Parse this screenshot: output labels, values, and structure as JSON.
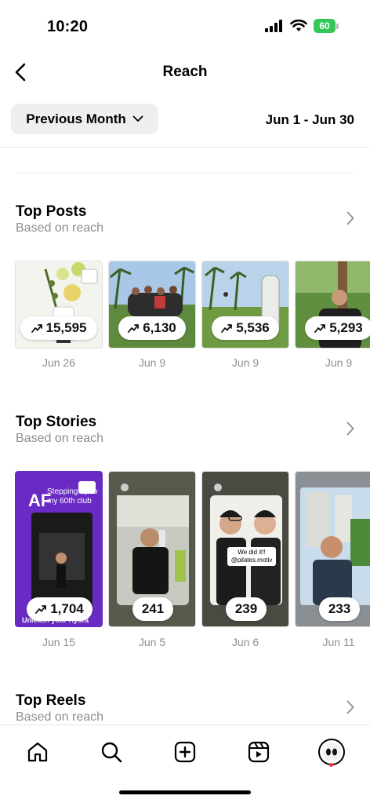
{
  "status": {
    "time": "10:20",
    "battery": "60"
  },
  "nav": {
    "title": "Reach",
    "back_icon": "chevron-left-icon"
  },
  "filter": {
    "period_label": "Previous Month",
    "date_range": "Jun 1 - Jun 30"
  },
  "top_posts": {
    "title": "Top Posts",
    "subtitle": "Based on reach",
    "items": [
      {
        "count": "15,595",
        "date": "Jun 26"
      },
      {
        "count": "6,130",
        "date": "Jun 9"
      },
      {
        "count": "5,536",
        "date": "Jun 9"
      },
      {
        "count": "5,293",
        "date": "Jun 9"
      }
    ]
  },
  "top_stories": {
    "title": "Top Stories",
    "subtitle": "Based on reach",
    "items": [
      {
        "count": "1,704",
        "date": "Jun 15",
        "caption": "Stepping up to my 60th club",
        "footer": "Unleash your Hydra"
      },
      {
        "count": "241",
        "date": "Jun 5"
      },
      {
        "count": "239",
        "date": "Jun 6",
        "caption": "We did it!! @pilates.motiv"
      },
      {
        "count": "233",
        "date": "Jun 11"
      }
    ]
  },
  "top_reels": {
    "title": "Top Reels",
    "subtitle": "Based on reach"
  },
  "tabs": [
    "home-icon",
    "search-icon",
    "create-icon",
    "reels-icon",
    "profile-avatar"
  ],
  "colors": {
    "battery": "#34c759",
    "story_purple": "#6a2bc4",
    "notification": "#ff3040"
  }
}
